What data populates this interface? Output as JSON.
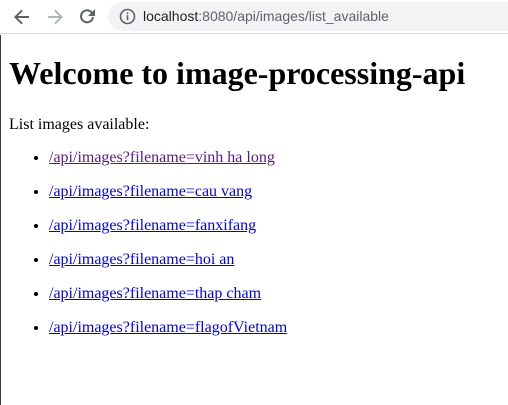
{
  "browser": {
    "url_host": "localhost",
    "url_path": ":8080/api/images/list_available",
    "back_icon": "arrow-left-icon",
    "forward_icon": "arrow-right-icon",
    "reload_icon": "reload-icon",
    "info_icon": "info-circle-icon"
  },
  "page": {
    "heading": "Welcome to image-processing-api",
    "intro": "List images available:",
    "images": [
      {
        "label": "/api/images?filename=vinh ha long",
        "visited": true
      },
      {
        "label": "/api/images?filename=cau vang",
        "visited": false
      },
      {
        "label": "/api/images?filename=fanxifang",
        "visited": false
      },
      {
        "label": "/api/images?filename=hoi an",
        "visited": false
      },
      {
        "label": "/api/images?filename=thap cham",
        "visited": false
      },
      {
        "label": "/api/images?filename=flagofVietnam",
        "visited": false
      }
    ]
  },
  "colors": {
    "link": "#0000ee",
    "visited_link": "#551a8b",
    "omnibox_bg": "#f1f3f4"
  }
}
